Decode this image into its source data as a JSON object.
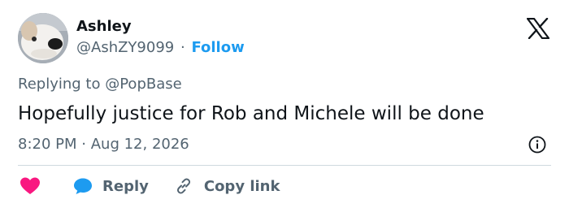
{
  "author": {
    "name": "Ashley",
    "handle": "@AshZY9099",
    "separator": "·",
    "follow_label": "Follow"
  },
  "reply_context": {
    "prefix": "Replying to",
    "mention": "@PopBase"
  },
  "tweet": {
    "text": "Hopefully justice for Rob and Michele will be done",
    "time": "8:20 PM",
    "date": "Aug 12, 2026",
    "time_separator": "·"
  },
  "actions": {
    "reply_label": "Reply",
    "copy_link_label": "Copy link"
  },
  "icons": {
    "logo": "x-logo-icon",
    "info": "info-icon",
    "like": "heart-icon",
    "reply": "speech-bubble-icon",
    "copy": "link-icon"
  },
  "colors": {
    "link_blue": "#1d9bf0",
    "like_pink": "#f91880",
    "secondary_text": "#536471",
    "primary_text": "#0f1419"
  }
}
